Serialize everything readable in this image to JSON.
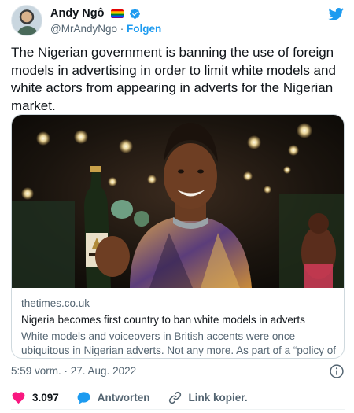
{
  "author": {
    "display_name": "Andy Ngô",
    "handle": "@MrAndyNgo",
    "separator": " · ",
    "follow_label": "Folgen",
    "flag_icon": "rainbow-flag-icon",
    "verified_icon": "verified-badge-icon"
  },
  "tweet": {
    "text": "The Nigerian government is banning the use of foreign models in advertising in order to limit white models and white actors from appearing in adverts for the Nigerian market."
  },
  "card": {
    "domain": "thetimes.co.uk",
    "title": "Nigeria becomes first country to ban white models in adverts",
    "description": "White models and voiceovers in British accents were once ubiquitous in Nigerian adverts. Not any more. As part of a “policy of developing ..."
  },
  "meta": {
    "timestamp": "5:59 vorm. · 27. Aug. 2022"
  },
  "actions": {
    "likes": "3.097",
    "reply_label": "Antworten",
    "copy_link_label": "Link kopier."
  },
  "colors": {
    "brand": "#1d9bf0",
    "like": "#f91880",
    "text_secondary": "#536471"
  }
}
